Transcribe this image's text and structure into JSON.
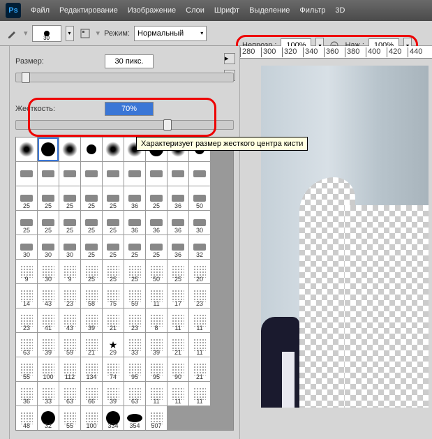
{
  "app": {
    "logo": "Ps"
  },
  "menu": [
    "Файл",
    "Редактирование",
    "Изображение",
    "Слои",
    "Шрифт",
    "Выделение",
    "Фильтр",
    "3D"
  ],
  "options": {
    "mode_label": "Режим:",
    "mode_value": "Нормальный",
    "opacity_label": "Непрозр.:",
    "opacity_value": "100%",
    "flow_label": "Наж.:",
    "flow_value": "100%",
    "brush_size_preview": "30"
  },
  "panel": {
    "size_label": "Размер:",
    "size_value": "30 пикс.",
    "hardness_label": "Жесткость:",
    "hardness_value": "70%"
  },
  "tooltip": "Характеризует размер жесткого центра кисти",
  "brushes": {
    "row3": [
      "25",
      "25",
      "25",
      "25",
      "25",
      "36",
      "25",
      "36",
      "50"
    ],
    "row4": [
      "25",
      "25",
      "25",
      "25",
      "25",
      "36",
      "36",
      "36",
      "30"
    ],
    "row5": [
      "30",
      "30",
      "30",
      "25",
      "25",
      "25",
      "25",
      "36",
      "32"
    ],
    "row6": [
      "9",
      "30",
      "9",
      "25",
      "25",
      "25",
      "50",
      "25",
      "20"
    ],
    "row7": [
      "14",
      "43",
      "23",
      "58",
      "75",
      "59",
      "11",
      "17",
      "23"
    ],
    "row8": [
      "23",
      "41",
      "43",
      "39",
      "21",
      "23",
      "8",
      "11",
      "11"
    ],
    "row9": [
      "63",
      "39",
      "59",
      "21",
      "29",
      "33",
      "39",
      "21",
      "11"
    ],
    "row10": [
      "55",
      "100",
      "112",
      "134",
      "74",
      "95",
      "95",
      "90",
      "21"
    ],
    "row11": [
      "36",
      "33",
      "63",
      "66",
      "39",
      "63",
      "11",
      "11",
      "11"
    ],
    "row12": [
      "48",
      "32",
      "55",
      "100",
      "334",
      "354",
      "507"
    ]
  },
  "ruler": [
    "280",
    "300",
    "320",
    "340",
    "360",
    "380",
    "400",
    "420",
    "440"
  ]
}
